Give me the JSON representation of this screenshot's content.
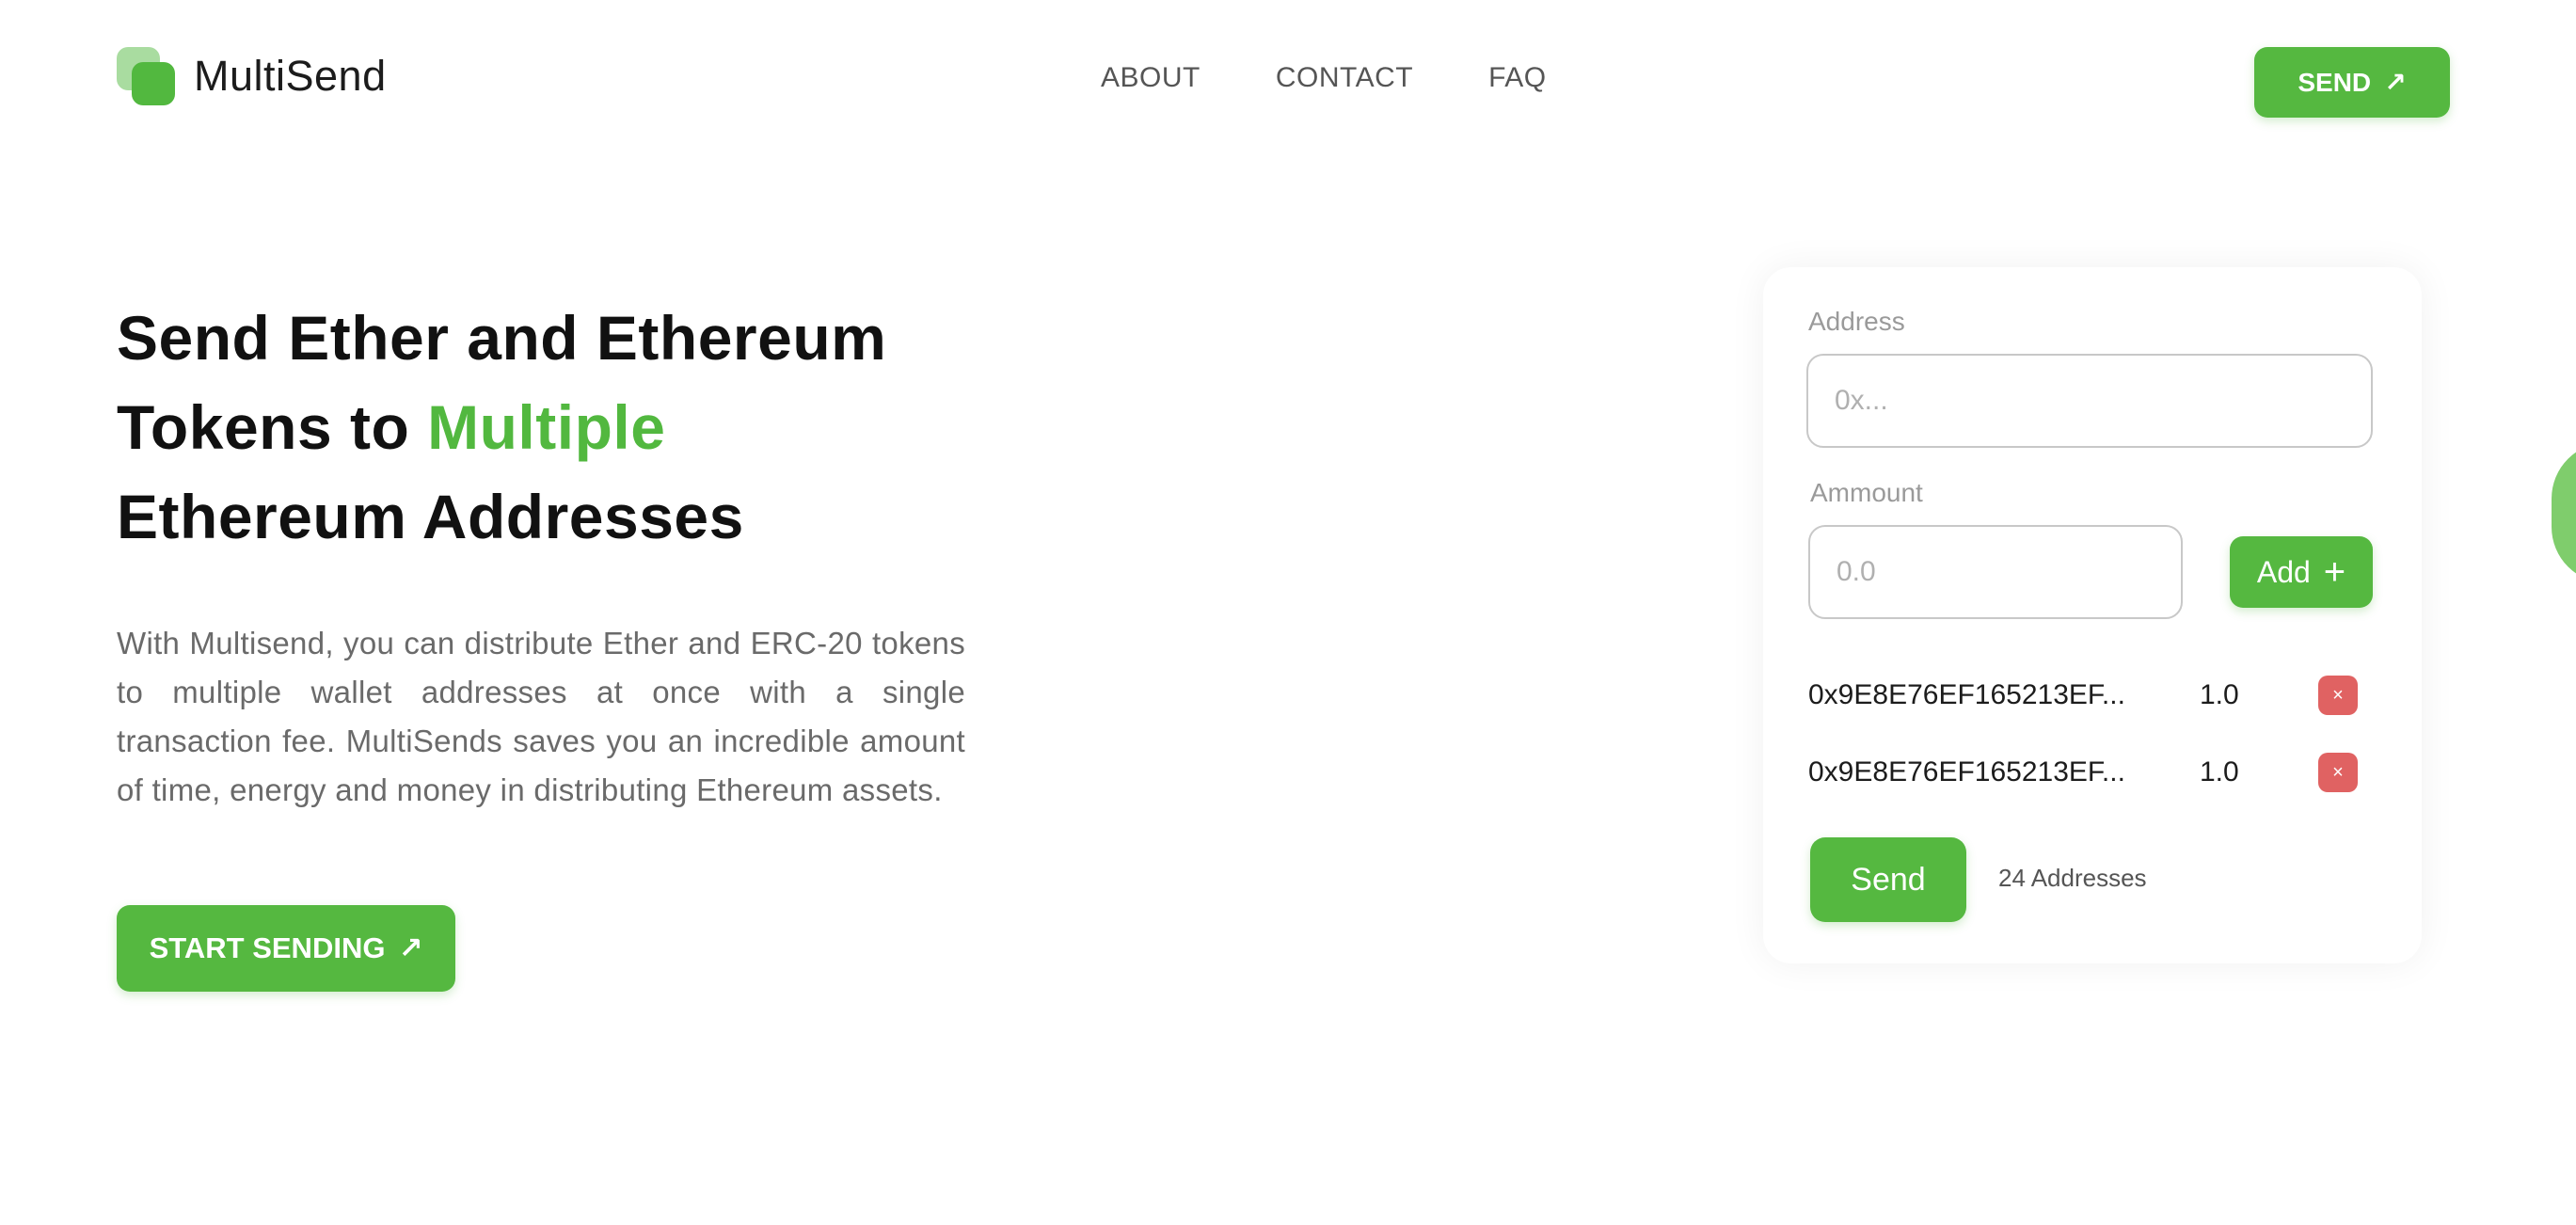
{
  "brand": {
    "name": "MultiSend"
  },
  "nav": [
    {
      "label": "ABOUT"
    },
    {
      "label": "CONTACT"
    },
    {
      "label": "FAQ"
    }
  ],
  "header": {
    "send_label": "SEND",
    "arrow": "↗"
  },
  "hero": {
    "title_part1": "Send Ether and Ethereum Tokens to ",
    "title_accent": "Multiple",
    "title_part2": "Ethereum Addresses",
    "description": "With Multisend, you can distribute Ether and ERC-20 tokens to multiple wallet addresses at once with a single transaction fee. MultiSends saves you an incredible amount of time, energy and money in distributing Ethereum assets.",
    "cta_label": "START SENDING",
    "cta_arrow": "↗"
  },
  "form": {
    "address_label": "Address",
    "address_placeholder": "0x...",
    "amount_label": "Ammount",
    "amount_placeholder": "0.0",
    "add_label": "Add",
    "add_icon": "+",
    "recipients": [
      {
        "address": "0x9E8E76EF165213EF...",
        "amount": "1.0",
        "remove_icon": "×"
      },
      {
        "address": "0x9E8E76EF165213EF...",
        "amount": "1.0",
        "remove_icon": "×"
      }
    ],
    "send_label": "Send",
    "address_count": "24 Addresses"
  },
  "colors": {
    "accent": "#55b840",
    "danger": "#e06262",
    "muted": "#6a6a6a"
  }
}
